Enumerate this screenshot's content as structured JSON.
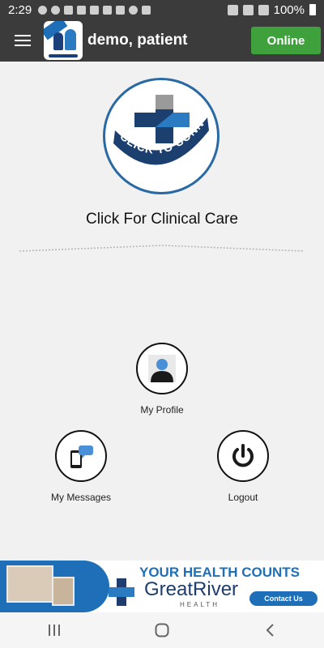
{
  "status_bar": {
    "time": "2:29",
    "battery": "100%",
    "icons": [
      "facebook-icon",
      "notification-icon",
      "snapchat-icon",
      "ghost-icon",
      "instagram-icon",
      "app-icon",
      "image-icon",
      "chat-icon",
      "close-box-icon",
      "mute-icon",
      "wifi-icon",
      "signal-icon",
      "battery-icon"
    ]
  },
  "app_bar": {
    "user_name": "demo, patient",
    "status_button": "Online",
    "status_color": "#3fa13c"
  },
  "main": {
    "logo_text": "CLICK TO CONNECT",
    "heading": "Click For Clinical Care",
    "menu": {
      "profile": "My Profile",
      "messages": "My Messages",
      "logout": "Logout"
    }
  },
  "banner": {
    "headline": "YOUR HEALTH COUNTS",
    "brand": "GreatRiver",
    "brand_sub": "HEALTH",
    "contact": "Contact Us",
    "accent": "#1e6fb8"
  },
  "colors": {
    "appbar": "#3b3b3b",
    "background": "#f1f1f1",
    "logo_ring": "#2a6aa4"
  }
}
